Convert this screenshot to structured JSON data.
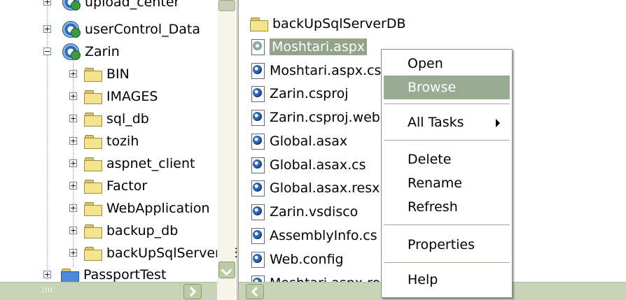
{
  "left_tree": {
    "items": [
      {
        "label": "upload_center"
      },
      {
        "label": "userControl_Data"
      },
      {
        "label": "Zarin"
      },
      {
        "label": "BIN"
      },
      {
        "label": "IMAGES"
      },
      {
        "label": "sql_db"
      },
      {
        "label": "tozih"
      },
      {
        "label": "aspnet_client"
      },
      {
        "label": "Factor"
      },
      {
        "label": "WebApplication"
      },
      {
        "label": "backup_db"
      },
      {
        "label": "backUpSqlServerDB"
      },
      {
        "label": "PassportTest"
      }
    ]
  },
  "file_list": {
    "items": [
      {
        "label": "backUpSqlServerDB"
      },
      {
        "label": "Moshtari.aspx"
      },
      {
        "label": "Moshtari.aspx.cs"
      },
      {
        "label": "Zarin.csproj"
      },
      {
        "label": "Zarin.csproj.webinfo"
      },
      {
        "label": "Global.asax"
      },
      {
        "label": "Global.asax.cs"
      },
      {
        "label": "Global.asax.resx"
      },
      {
        "label": "Zarin.vsdisco"
      },
      {
        "label": "AssemblyInfo.cs"
      },
      {
        "label": "Web.config"
      },
      {
        "label": "Moshtari.aspx.resx"
      }
    ]
  },
  "context_menu": {
    "open": "Open",
    "browse": "Browse",
    "all_tasks": "All Tasks",
    "delete": "Delete",
    "rename": "Rename",
    "refresh": "Refresh",
    "properties": "Properties",
    "help": "Help"
  },
  "colors": {
    "selection": "#93a48b",
    "menu_hover": "#9aab94"
  }
}
